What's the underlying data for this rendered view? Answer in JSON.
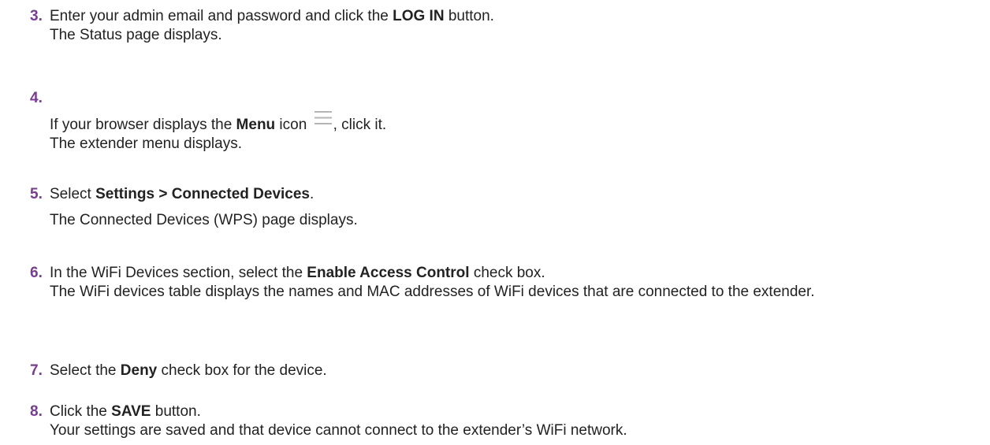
{
  "steps": [
    {
      "number": "3.",
      "parts": [
        "Enter your admin email and password and click the ",
        "LOG IN",
        " button."
      ],
      "result": "The Status page displays."
    },
    {
      "number": "4.",
      "parts": [
        "If your browser displays the ",
        "Menu",
        " icon ",
        ", click it."
      ],
      "icon": "menu-icon",
      "result": "The extender menu displays."
    },
    {
      "number": "5.",
      "parts": [
        "Select ",
        "Settings > Connected Devices",
        "."
      ],
      "result": "The Connected Devices (WPS) page displays."
    },
    {
      "number": "6.",
      "parts": [
        "In the WiFi Devices section, select the ",
        "Enable Access Control",
        " check box."
      ],
      "result": "The WiFi devices table displays the names and MAC addresses of WiFi devices that are connected to the extender."
    },
    {
      "number": "7.",
      "parts": [
        "Select the ",
        "Deny",
        " check box for the device."
      ]
    },
    {
      "number": "8.",
      "parts": [
        "Click the ",
        "SAVE",
        " button."
      ],
      "result": "Your settings are saved and that device cannot connect to the extender’s WiFi network."
    }
  ],
  "colors": {
    "step_number": "#7a3a96",
    "text": "#222222",
    "icon": "#b5b5b5"
  }
}
